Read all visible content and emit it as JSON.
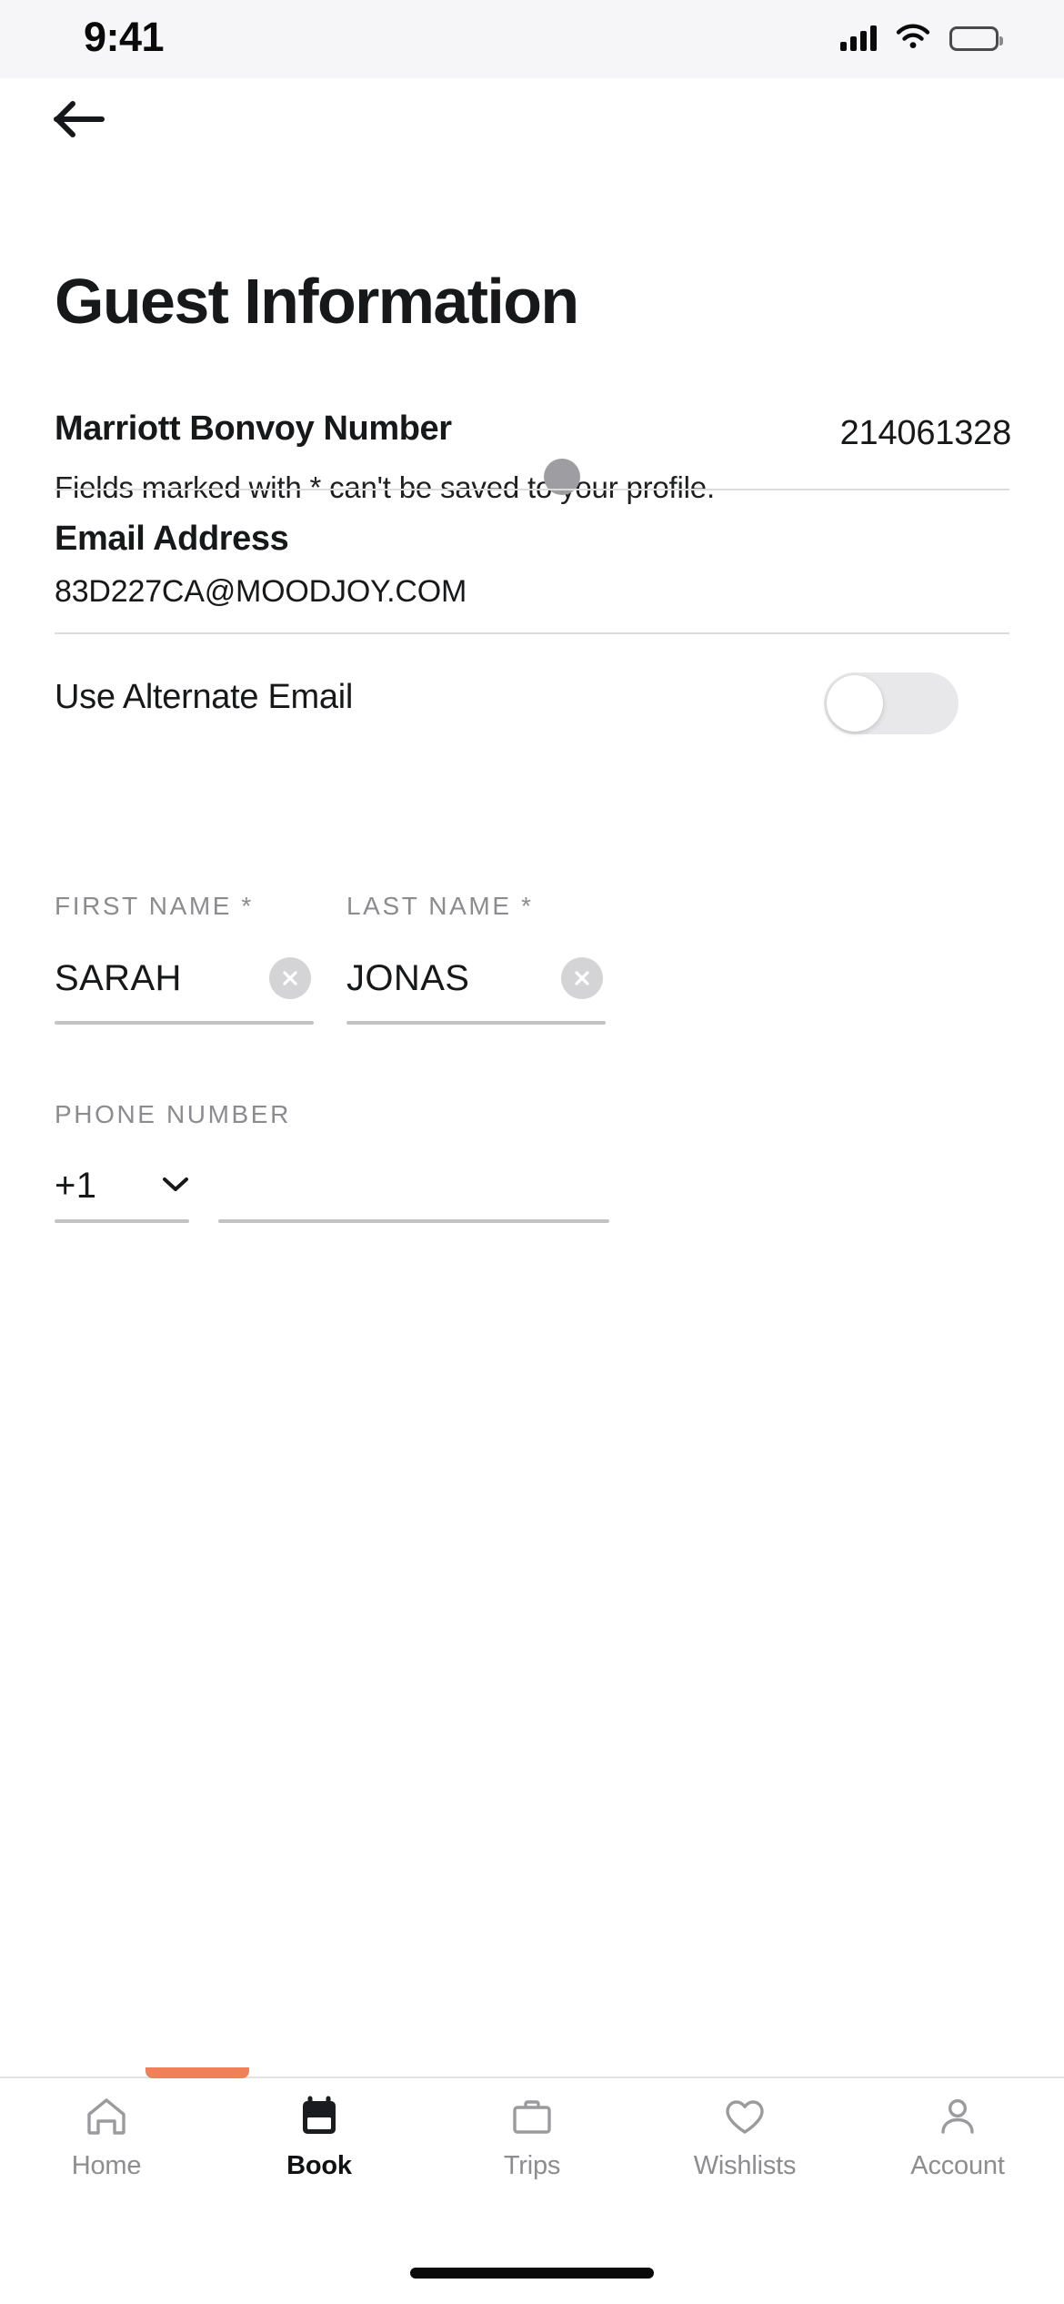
{
  "status_bar": {
    "time": "9:41",
    "icons": [
      "cellular-signal-icon",
      "wifi-icon",
      "battery-icon"
    ]
  },
  "header": {
    "back_icon": "back-arrow-icon",
    "title": "Guest Information",
    "subtitle": "Fields marked with * can't be saved to your profile."
  },
  "form": {
    "bonvoy": {
      "label": "Marriott Bonvoy Number",
      "value": "214061328"
    },
    "email": {
      "label": "Email Address",
      "value": "83D227CA@MOODJOY.COM"
    },
    "alternate_email": {
      "label": "Use Alternate Email",
      "toggle_state": "off"
    },
    "first_name": {
      "label": "FIRST NAME *",
      "value": "SARAH",
      "clear_icon": "clear-circle-icon"
    },
    "last_name": {
      "label": "LAST NAME *",
      "value": "JONAS",
      "clear_icon": "clear-circle-icon"
    },
    "phone": {
      "label": "PHONE NUMBER",
      "country_code": "+1",
      "chevron_icon": "chevron-down-icon",
      "number": "",
      "placeholder": ""
    }
  },
  "tab_bar": {
    "active_index": 1,
    "accent_color": "#ef8057",
    "items": [
      {
        "label": "Home",
        "icon": "home-icon"
      },
      {
        "label": "Book",
        "icon": "calendar-icon"
      },
      {
        "label": "Trips",
        "icon": "briefcase-icon"
      },
      {
        "label": "Wishlists",
        "icon": "heart-icon"
      },
      {
        "label": "Account",
        "icon": "person-icon"
      }
    ]
  }
}
